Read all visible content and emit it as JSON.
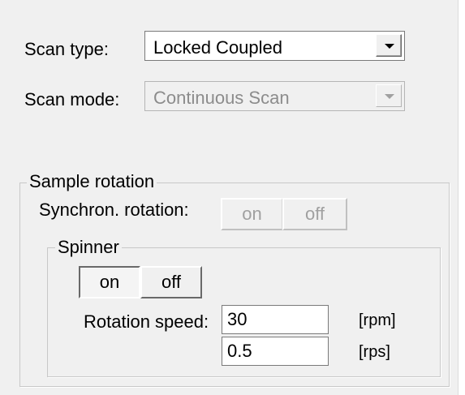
{
  "scan_type": {
    "label": "Scan type:",
    "selected": "Locked Coupled"
  },
  "scan_mode": {
    "label": "Scan mode:",
    "selected": "Continuous Scan"
  },
  "sample_rotation": {
    "title": "Sample rotation",
    "synchron_label": "Synchron. rotation:",
    "synchron_on": "on",
    "synchron_off": "off",
    "spinner": {
      "title": "Spinner",
      "on": "on",
      "off": "off",
      "state": "on",
      "rotation_speed_label": "Rotation speed:",
      "rpm_value": "30",
      "rpm_unit": "[rpm]",
      "rps_value": "0.5",
      "rps_unit": "[rps]"
    }
  }
}
